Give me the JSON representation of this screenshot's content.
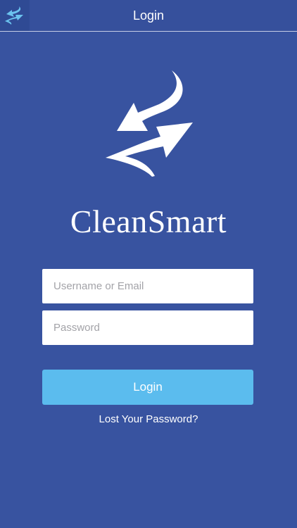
{
  "nav": {
    "title": "Login",
    "logo_icon": "cleansmart-logo-icon"
  },
  "brand": {
    "name": "CleanSmart",
    "logo_icon": "cleansmart-arrows-logo"
  },
  "form": {
    "username_placeholder": "Username or Email",
    "password_placeholder": "Password",
    "username_value": "",
    "password_value": "",
    "login_label": "Login",
    "lost_password_label": "Lost Your Password?"
  },
  "colors": {
    "background": "#3853a0",
    "button": "#5bbcee",
    "text": "#ffffff"
  }
}
